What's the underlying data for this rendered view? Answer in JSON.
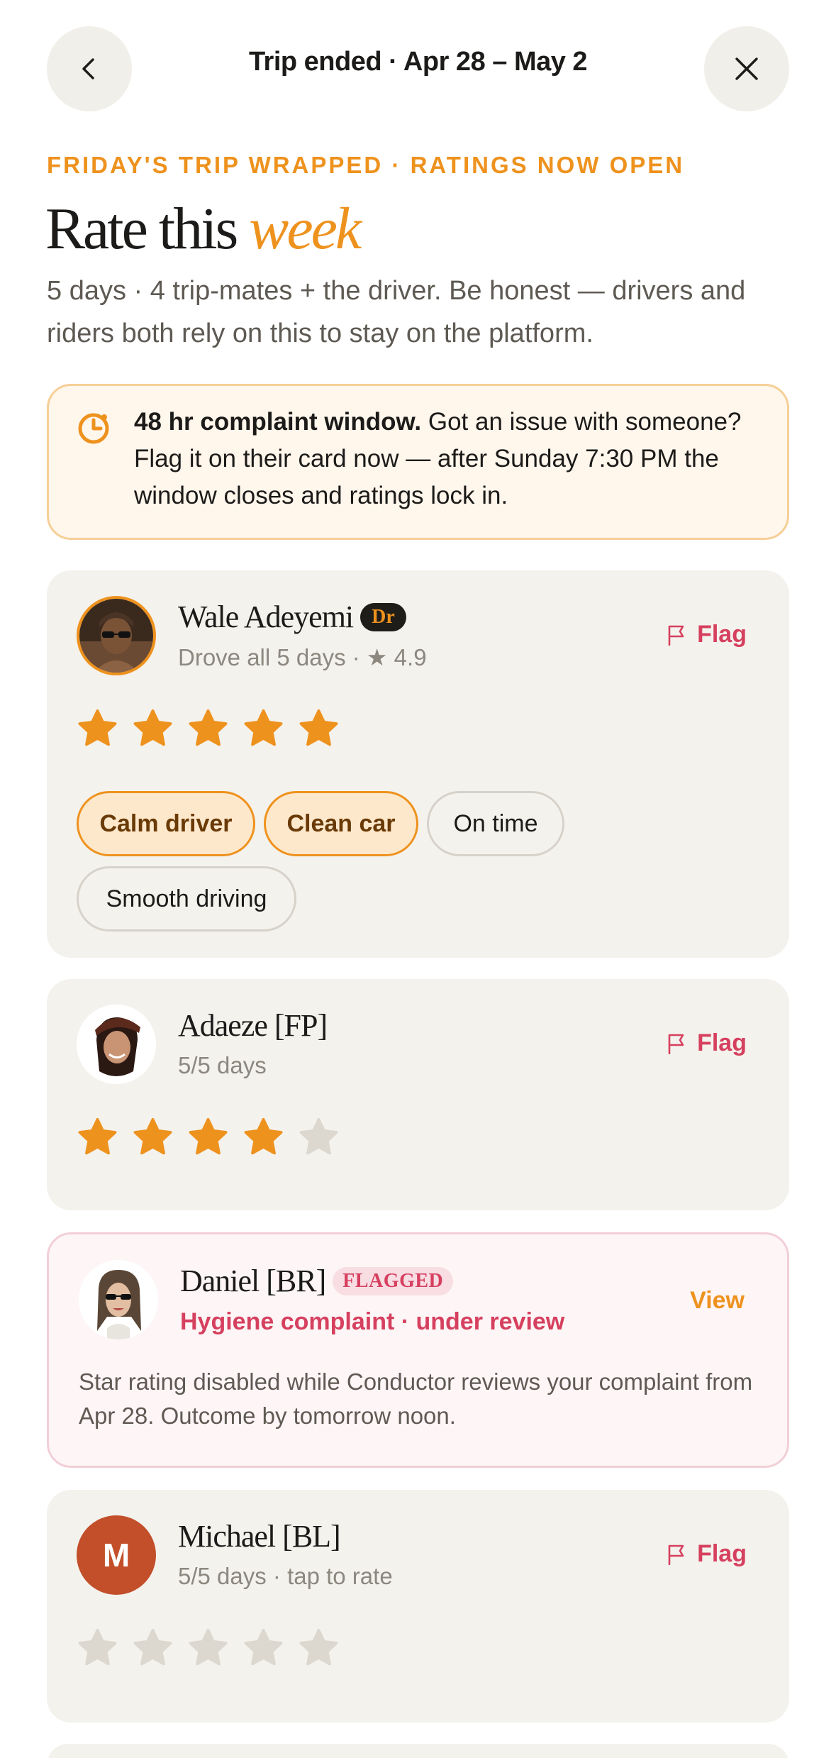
{
  "header": {
    "title": "Trip ended · Apr 28 – May 2",
    "back_icon": "chevron-left-icon",
    "close_icon": "close-icon"
  },
  "intro": {
    "eyebrow": "FRIDAY'S TRIP WRAPPED · RATINGS NOW OPEN",
    "headline_prefix": "Rate this",
    "headline_accent": "week",
    "subtext": "5 days · 4 trip-mates + the driver. Be honest — drivers and riders both rely on this to stay on the platform."
  },
  "notice": {
    "icon": "clock-icon",
    "bold": "48 hr complaint window.",
    "text": " Got an issue with someone? Flag it on their card now — after Sunday 7:30 PM the window closes and ratings lock in."
  },
  "cards": [
    {
      "name": "Wale Adeyemi",
      "badge": "Dr",
      "meta": "Drove all 5 days · ★ 4.9",
      "action": "Flag",
      "rating": 5,
      "tags": [
        {
          "label": "Calm driver",
          "selected": true
        },
        {
          "label": "Clean car",
          "selected": true
        },
        {
          "label": "On time",
          "selected": false
        },
        {
          "label": "Smooth driving",
          "selected": false
        }
      ]
    },
    {
      "name": "Adaeze [FP]",
      "meta": "5/5 days",
      "action": "Flag",
      "rating": 4
    },
    {
      "name": "Daniel [BR]",
      "badge": "FLAGGED",
      "meta": "Hygiene complaint · under review",
      "action": "View",
      "description": "Star rating disabled while Conductor reviews your complaint from Apr 28. Outcome by tomorrow noon."
    },
    {
      "name": "Michael [BL]",
      "initial": "M",
      "meta": "5/5 days · tap to rate",
      "action": "Flag",
      "rating": 0
    }
  ],
  "colors": {
    "accent": "#ee921e",
    "alert": "#d6405f",
    "card_bg": "#f4f2ed",
    "star_off": "#dcd8cf"
  }
}
